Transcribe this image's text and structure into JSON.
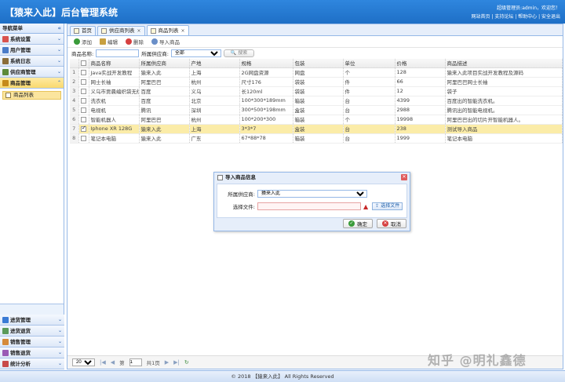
{
  "header": {
    "title": "【猿来入此】后台管理系统",
    "welcome": "超级管理员:admin，欢迎您！",
    "links": "网站首页 | 支持论坛 | 帮助中心 | 安全退出"
  },
  "sidebar": {
    "head": "导航菜单",
    "top_menus": [
      {
        "label": "系统设置",
        "icon_color": "#d9534f"
      },
      {
        "label": "用户管理",
        "icon_color": "#4a7bc8"
      },
      {
        "label": "系统日志",
        "icon_color": "#8a6d3b"
      },
      {
        "label": "供应商管理",
        "icon_color": "#5c8a3a"
      },
      {
        "label": "商品管理",
        "icon_color": "#c58a1a"
      }
    ],
    "sub_item": "商品列表",
    "bottom_menus": [
      {
        "label": "进货管理",
        "icon_color": "#3a7bd5"
      },
      {
        "label": "进货退货",
        "icon_color": "#5a9a5a"
      },
      {
        "label": "销售管理",
        "icon_color": "#d58a3a"
      },
      {
        "label": "销售退货",
        "icon_color": "#9a5ab5"
      },
      {
        "label": "统计分析",
        "icon_color": "#c84a4a"
      }
    ]
  },
  "tabs": [
    "首页",
    "供应商列表",
    "商品列表"
  ],
  "toolbar": {
    "add": "添加",
    "edit": "编辑",
    "delete": "删除",
    "import": "导入商品"
  },
  "search": {
    "name_label": "商品名称:",
    "supplier_label": "所属供应商:",
    "supplier_value": "全部",
    "search_btn": "搜索"
  },
  "table": {
    "columns": [
      "商品名称",
      "所属供应商",
      "产地",
      "规格",
      "包装",
      "单位",
      "价格",
      "商品描述"
    ],
    "rows": [
      [
        "Java实战开发教程",
        "猿来入此",
        "上海",
        "2G网盘资源",
        "网盘",
        "个",
        "128",
        "猿来入此项目实战开发教程及源码"
      ],
      [
        "网士长袖",
        "阿里巴巴",
        "杭州",
        "尺寸176",
        "袋装",
        "件",
        "66",
        "阿里巴巴网士长袖"
      ],
      [
        "义乌市贾晨编织袋无纺",
        "百度",
        "义乌",
        "长120ml",
        "袋装",
        "件",
        "12",
        "袋子"
      ],
      [
        "洗衣机",
        "百度",
        "北京",
        "100*300*189mm",
        "箱装",
        "台",
        "4399",
        "百度出的智能洗衣机。"
      ],
      [
        "电视机",
        "腾讯",
        "深圳",
        "300*500*198mm",
        "盒装",
        "台",
        "2988",
        "腾讯出的智能电视机。"
      ],
      [
        "智能机器人",
        "阿里巴巴",
        "杭州",
        "100*200*300",
        "箱装",
        "个",
        "19998",
        "阿里巴巴出的切片开智能机器人。"
      ],
      [
        "Iphone XR 128G",
        "猿来入此",
        "上海",
        "3*3*7",
        "盒装",
        "台",
        "238",
        "测试导入商品"
      ],
      [
        "笔记本电脑",
        "猿来入此",
        "广东",
        "67*88*78",
        "箱装",
        "台",
        "1999",
        "笔记本电脑"
      ]
    ]
  },
  "pager": {
    "size": "20",
    "page_label_pre": "第",
    "page": "1",
    "page_label_post": "共1页"
  },
  "dialog": {
    "title": "导入商品信息",
    "supplier_label": "所属供应商:",
    "supplier_value": "猿来入此",
    "file_label": "选择文件:",
    "file_btn": "选择文件",
    "ok": "确定",
    "cancel": "取消"
  },
  "footer": "© 2018 【猿来入此】 All Rights Reserved",
  "watermark": "知乎 @明礼鑫德"
}
